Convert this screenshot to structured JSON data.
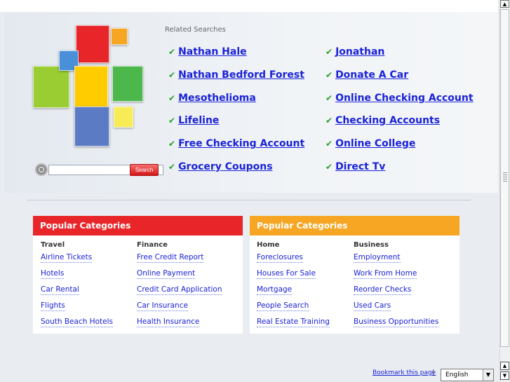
{
  "related": {
    "title": "Related Searches",
    "check_icon": "checkmark-icon",
    "items": [
      "Nathan Hale",
      "Jonathan",
      "Nathan Bedford Forest",
      "Donate A Car",
      "Mesothelioma",
      "Online Checking Account",
      "Lifeline",
      "Checking Accounts",
      "Free Checking Account",
      "Online College",
      "Grocery Coupons",
      "Direct Tv"
    ]
  },
  "search": {
    "placeholder": "",
    "button_label": "Search",
    "icon": "magnifier-icon"
  },
  "popular": {
    "left": {
      "heading": "Popular Categories",
      "color": "#e8262a",
      "columns": [
        {
          "title": "Travel",
          "links": [
            "Airline Tickets",
            "Hotels",
            "Car Rental",
            "Flights",
            "South Beach Hotels"
          ]
        },
        {
          "title": "Finance",
          "links": [
            "Free Credit Report",
            "Online Payment",
            "Credit Card Application",
            "Car Insurance",
            "Health Insurance"
          ]
        }
      ]
    },
    "right": {
      "heading": "Popular Categories",
      "color": "#f6a623",
      "columns": [
        {
          "title": "Home",
          "links": [
            "Foreclosures",
            "Houses For Sale",
            "Mortgage",
            "People Search",
            "Real Estate Training"
          ]
        },
        {
          "title": "Business",
          "links": [
            "Employment",
            "Work From Home",
            "Reorder Checks",
            "Used Cars",
            "Business Opportunities"
          ]
        }
      ]
    }
  },
  "footer": {
    "bookmark_label": "Bookmark this page",
    "separator": "|",
    "language": "English"
  },
  "colors": {
    "link": "#1a22d8",
    "check": "#2aa12a",
    "logo_red": "#e8262a",
    "logo_orange": "#f6a623",
    "logo_blue": "#4a90d9",
    "logo_green": "#9acd32",
    "logo_yellow": "#ffcc00",
    "logo_darkgreen": "#4cb84c",
    "logo_navy": "#5b7cc4",
    "logo_lightyellow": "#f7ec55"
  }
}
